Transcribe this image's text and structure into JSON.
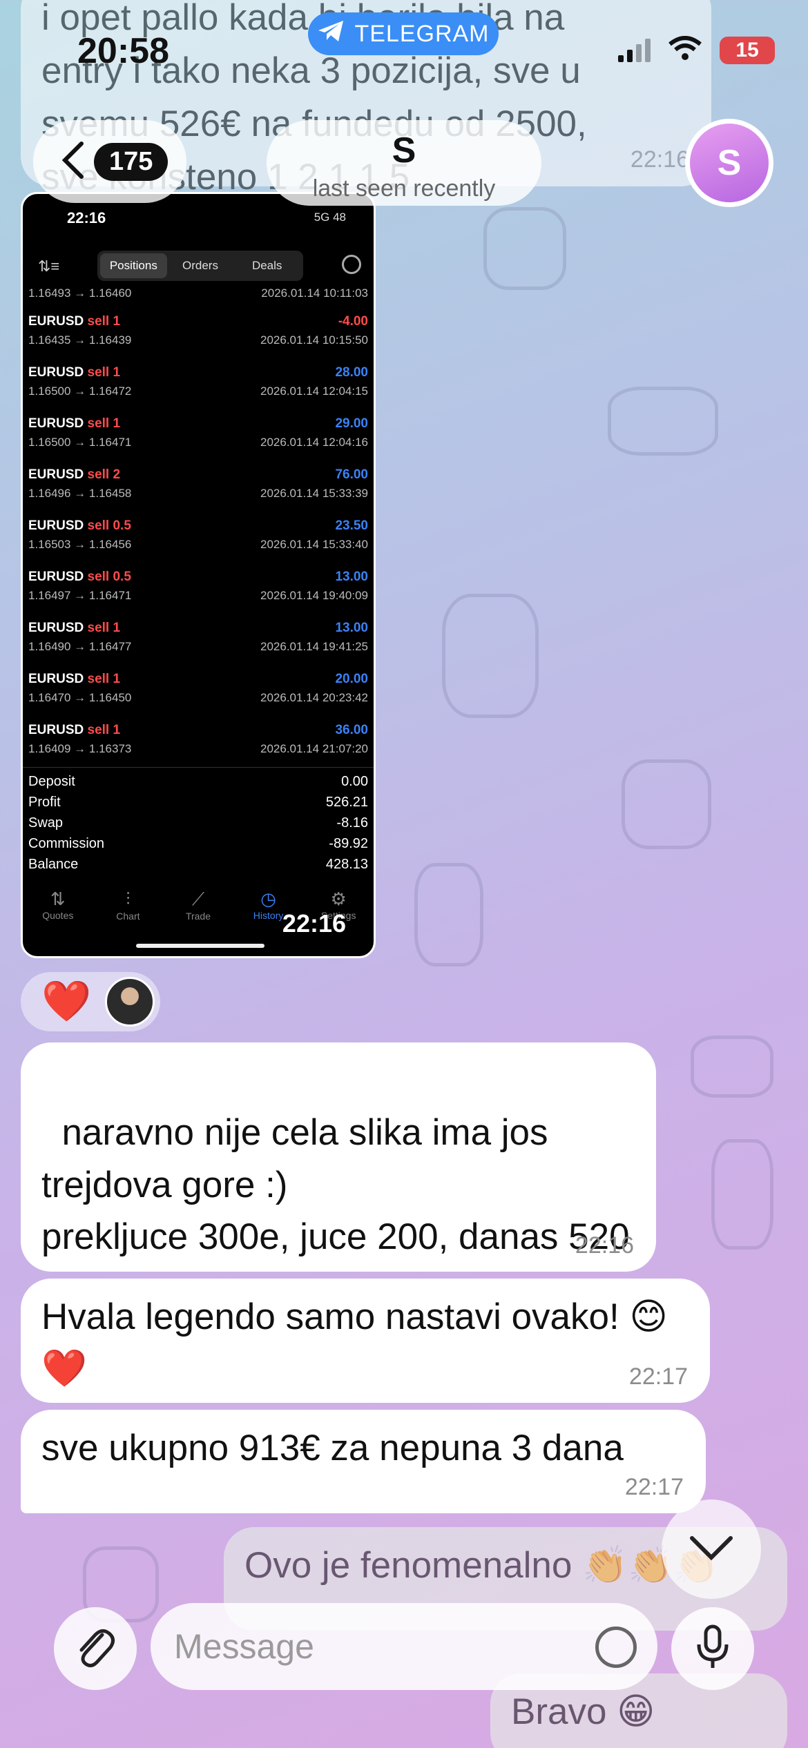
{
  "status_bar": {
    "time": "20:58",
    "app_pill": "TELEGRAM",
    "battery": "15"
  },
  "header": {
    "back_count": "175",
    "contact_name": "S",
    "contact_status": "last seen recently",
    "avatar_letter": "S"
  },
  "messages": {
    "top_partial": {
      "lines": [
        "i opet pallo kada bi berila bila na",
        "entry i tako neka 3 pozicija, sve u",
        "svemu 526€ na fundedu od 2500,",
        "sve koristeno 1 2 1 1.5"
      ],
      "time": "22:16"
    },
    "image_time": "22:16",
    "m1": {
      "text": "naravno nije cela slika ima jos trejdova gore :)\nprekljuce 300e, juce 200, danas 520",
      "time": "22:16"
    },
    "m2": {
      "text": "Hvala legendo samo nastavi ovako! 😊❤️",
      "time": "22:17"
    },
    "m3": {
      "text": "sve ukupno 913€ za nepuna 3 dana",
      "time": "22:17"
    },
    "out1": {
      "text": "Ovo je fenomenalno 👏👏👏"
    },
    "out2": {
      "text": "Bravo 😁"
    }
  },
  "reaction": {
    "emoji": "❤️"
  },
  "photo": {
    "status_time": "22:16",
    "status_right": "5G 48",
    "tabs": [
      "Positions",
      "Orders",
      "Deals"
    ],
    "active_tab": "Positions",
    "first_row": {
      "prices": "1.16493 → 1.16460",
      "date": "2026.01.14 10:11:03"
    },
    "deals": [
      {
        "symbol": "EURUSD",
        "side": "sell 1",
        "profit": "-4.00",
        "color": "#ff4c4c",
        "prices": "1.16435 → 1.16439",
        "date": "2026.01.14 10:15:50"
      },
      {
        "symbol": "EURUSD",
        "side": "sell 1",
        "profit": "28.00",
        "color": "#3b82f6",
        "prices": "1.16500 → 1.16472",
        "date": "2026.01.14 12:04:15"
      },
      {
        "symbol": "EURUSD",
        "side": "sell 1",
        "profit": "29.00",
        "color": "#3b82f6",
        "prices": "1.16500 → 1.16471",
        "date": "2026.01.14 12:04:16"
      },
      {
        "symbol": "EURUSD",
        "side": "sell 2",
        "profit": "76.00",
        "color": "#3b82f6",
        "prices": "1.16496 → 1.16458",
        "date": "2026.01.14 15:33:39"
      },
      {
        "symbol": "EURUSD",
        "side": "sell 0.5",
        "profit": "23.50",
        "color": "#3b82f6",
        "prices": "1.16503 → 1.16456",
        "date": "2026.01.14 15:33:40"
      },
      {
        "symbol": "EURUSD",
        "side": "sell 0.5",
        "profit": "13.00",
        "color": "#3b82f6",
        "prices": "1.16497 → 1.16471",
        "date": "2026.01.14 19:40:09"
      },
      {
        "symbol": "EURUSD",
        "side": "sell 1",
        "profit": "13.00",
        "color": "#3b82f6",
        "prices": "1.16490 → 1.16477",
        "date": "2026.01.14 19:41:25"
      },
      {
        "symbol": "EURUSD",
        "side": "sell 1",
        "profit": "20.00",
        "color": "#3b82f6",
        "prices": "1.16470 → 1.16450",
        "date": "2026.01.14 20:23:42"
      },
      {
        "symbol": "EURUSD",
        "side": "sell 1",
        "profit": "36.00",
        "color": "#3b82f6",
        "prices": "1.16409 → 1.16373",
        "date": "2026.01.14 21:07:20"
      }
    ],
    "summary": [
      {
        "label": "Deposit",
        "value": "0.00"
      },
      {
        "label": "Profit",
        "value": "526.21"
      },
      {
        "label": "Swap",
        "value": "-8.16"
      },
      {
        "label": "Commission",
        "value": "-89.92"
      },
      {
        "label": "Balance",
        "value": "428.13"
      }
    ],
    "nav": [
      "Quotes",
      "Chart",
      "Trade",
      "History",
      "Settings"
    ],
    "nav_active": "History"
  },
  "composer": {
    "placeholder": "Message"
  }
}
